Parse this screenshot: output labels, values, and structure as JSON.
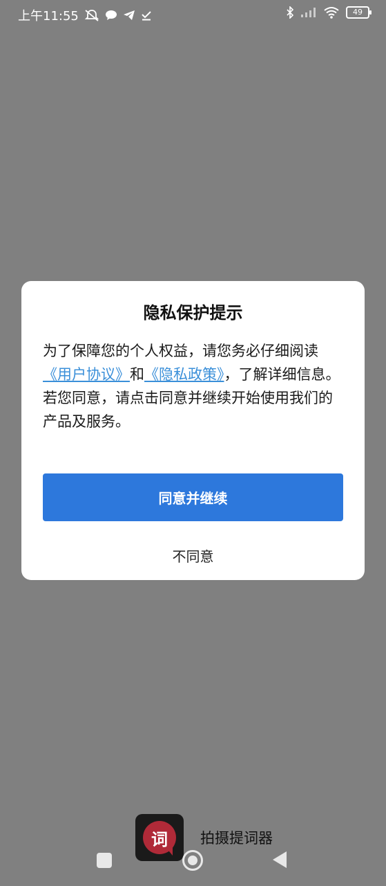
{
  "status_bar": {
    "time": "上午11:55",
    "left_icons": [
      "notifications-off-icon",
      "chat-bubble-icon",
      "telegram-send-icon",
      "download-done-icon"
    ],
    "right_icons": [
      "bluetooth-icon",
      "signal-icon",
      "wifi-icon"
    ],
    "battery": "49"
  },
  "dialog": {
    "title": "隐私保护提示",
    "text_part1": "为了保障您的个人权益，请您务必仔细阅读",
    "link_user_agreement": "《用户协议》",
    "text_and": "和",
    "link_privacy_policy": "《隐私政策》",
    "text_part2": "，了解详细信息。 若您同意，请点击同意并继续开始使用我们的产品及服务。",
    "agree_label": "同意并继续",
    "disagree_label": "不同意"
  },
  "app": {
    "icon_char": "词",
    "name": "拍摄提词器"
  },
  "colors": {
    "accent": "#2d78dc",
    "link": "#3a8fd9",
    "overlay": "#808080"
  }
}
